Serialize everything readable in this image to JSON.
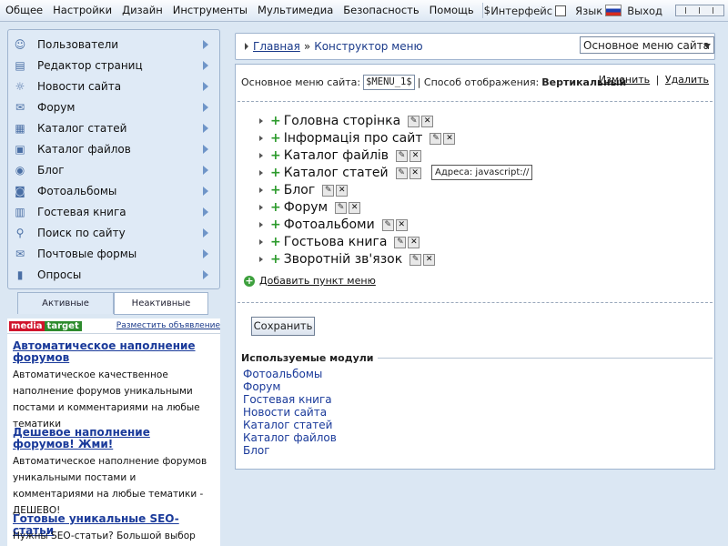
{
  "topmenu": [
    "Общее",
    "Настройки",
    "Дизайн",
    "Инструменты",
    "Мультимедиа",
    "Безопасность",
    "Помощь",
    "$"
  ],
  "topright": {
    "interface_label": "Интерфейс",
    "language_label": "Язык",
    "logout_label": "Выход"
  },
  "sidebar": {
    "items": [
      {
        "label": "Пользователи",
        "icon": "users-icon"
      },
      {
        "label": "Редактор страниц",
        "icon": "page-editor-icon"
      },
      {
        "label": "Новости сайта",
        "icon": "news-icon"
      },
      {
        "label": "Форум",
        "icon": "forum-icon"
      },
      {
        "label": "Каталог статей",
        "icon": "articles-icon"
      },
      {
        "label": "Каталог файлов",
        "icon": "files-icon"
      },
      {
        "label": "Блог",
        "icon": "blog-icon"
      },
      {
        "label": "Фотоальбомы",
        "icon": "photo-icon"
      },
      {
        "label": "Гостевая книга",
        "icon": "guestbook-icon"
      },
      {
        "label": "Поиск по сайту",
        "icon": "search-icon"
      },
      {
        "label": "Почтовые формы",
        "icon": "mail-icon"
      },
      {
        "label": "Опросы",
        "icon": "poll-icon"
      }
    ],
    "tab_active": "Активные",
    "tab_inactive": "Неактивные"
  },
  "ads": {
    "logo_media": "media",
    "logo_target": "target",
    "place_ad": "Разместить объявление",
    "items": [
      {
        "title": "Автоматическое наполнение форумов",
        "text": "Автоматическое качественное наполнение форумов уникальными постами и комментариями на любые тематики"
      },
      {
        "title": "Дешевое наполнение форумов! Жми!",
        "text": "Автоматическое наполнение форумов уникальными постами и комментариями на любые тематики - ДЕШЕВО!"
      },
      {
        "title": "Готовые уникальные SEO-статьи",
        "text": "Нужны SEO-статьи? Большой выбор"
      }
    ]
  },
  "breadcrumb": {
    "home": "Главная",
    "separator": "»",
    "current": "Конструктор меню"
  },
  "menu_select": {
    "value": "Основное меню сайта"
  },
  "info": {
    "menu_label": "Основное меню сайта:",
    "code": "$MENU_1$",
    "display_label": "| Способ отображения:",
    "display_value": "Вертикальный",
    "edit": "Изменить",
    "delete": "Удалить",
    "divider": "|"
  },
  "menu_items": [
    "Головна сторінка",
    "Інформація про сайт",
    "Каталог файлів",
    "Каталог статей",
    "Блог",
    "Форум",
    "Фотоальбоми",
    "Гостьова книга",
    "Зворотній зв'язок"
  ],
  "tooltip": "Адреса: javascript://",
  "add_item": "Добавить пункт меню",
  "save_button": "Сохранить",
  "modules": {
    "title": "Используемые модули",
    "items": [
      "Фотоальбомы",
      "Форум",
      "Гостевая книга",
      "Новости сайта",
      "Каталог статей",
      "Каталог файлов",
      "Блог"
    ]
  }
}
